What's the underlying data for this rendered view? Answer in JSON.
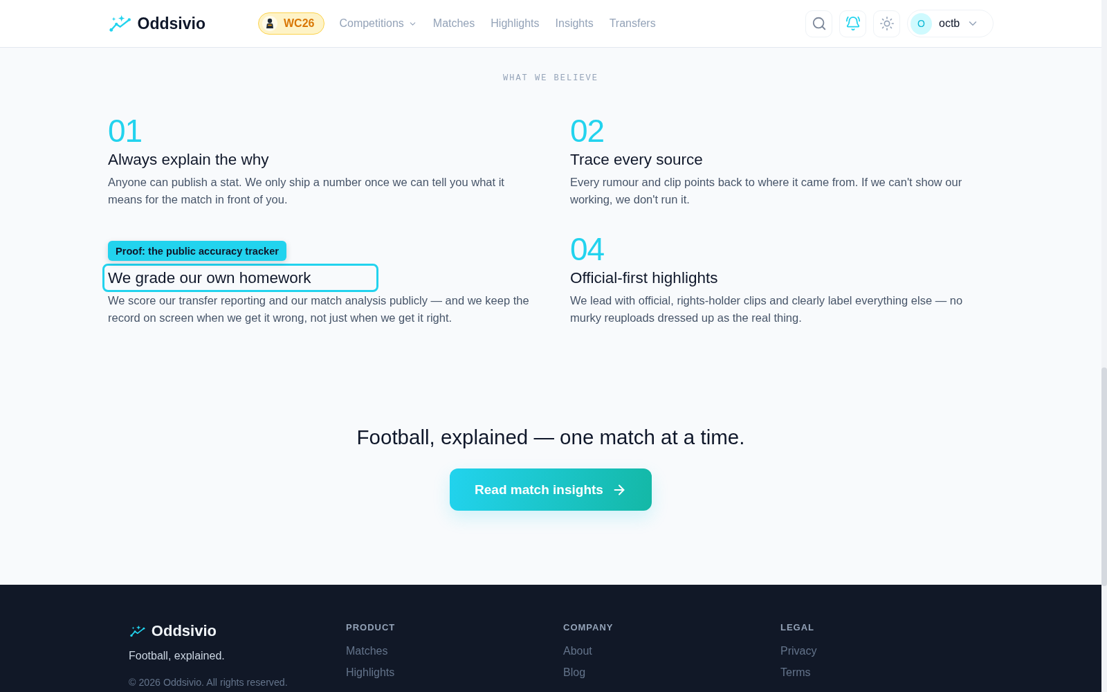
{
  "header": {
    "brand": "Oddsivio",
    "event_badge": "WC26",
    "nav": [
      {
        "label": "Competitions",
        "dropdown": true
      },
      {
        "label": "Matches",
        "dropdown": false
      },
      {
        "label": "Highlights",
        "dropdown": false
      },
      {
        "label": "Insights",
        "dropdown": false
      },
      {
        "label": "Transfers",
        "dropdown": false
      }
    ],
    "notifications_on": true,
    "user": {
      "initial": "O",
      "name": "octb"
    }
  },
  "beliefs": {
    "eyebrow": "WHAT WE BELIEVE",
    "rows": [
      [
        {
          "number": "01",
          "title": "Always explain the why",
          "text": "Anyone can publish a stat. We only ship a number once we can tell you what it means for the match in front of you.",
          "focused": false
        },
        {
          "number": "02",
          "title": "Trace every source",
          "text": "Every rumour and clip points back to where it came from. If we can't show our working, we don't run it.",
          "focused": false
        }
      ],
      [
        {
          "title": "We grade our own homework",
          "text": "We score our transfer reporting and our match analysis publicly — and we keep the record on screen when we get it wrong, not just when we get it right.",
          "focused": true,
          "tooltip": "Proof: the public accuracy tracker"
        },
        {
          "number": "04",
          "title": "Official-first highlights",
          "text": "We lead with official, rights-holder clips and clearly label everything else — no murky reuploads dressed up as the real thing.",
          "focused": false
        }
      ]
    ]
  },
  "cta": {
    "headline": "Football, explained — one match at a time.",
    "button": "Read match insights"
  },
  "footer": {
    "brand": "Oddsivio",
    "tagline": "Football, explained.",
    "copyright": "© 2026 Oddsivio. All rights reserved.",
    "columns": [
      {
        "heading": "PRODUCT",
        "links": [
          "Matches",
          "Highlights"
        ]
      },
      {
        "heading": "COMPANY",
        "links": [
          "About",
          "Blog"
        ]
      },
      {
        "heading": "LEGAL",
        "links": [
          "Privacy",
          "Terms"
        ]
      }
    ]
  }
}
